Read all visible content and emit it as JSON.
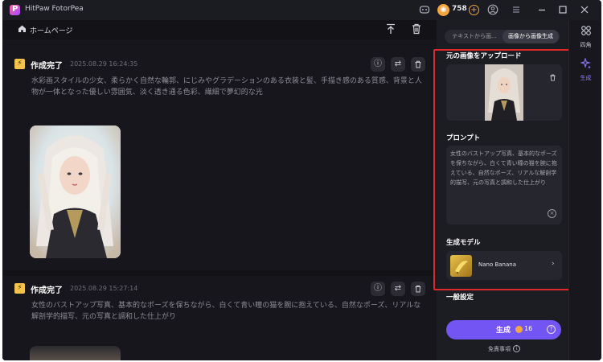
{
  "titlebar": {
    "app_title": "HitPaw FotorPea",
    "coins": "758",
    "icons": [
      "discord-icon",
      "coin-icon",
      "plus-icon",
      "user-icon",
      "menu-icon",
      "minimize-icon",
      "maximize-icon",
      "close-icon"
    ]
  },
  "left": {
    "breadcrumb": "ホームページ",
    "cards": [
      {
        "status": "作成完了",
        "time": "2025.08.29 16:24:35",
        "text": "水彩画スタイルの少女、柔らかく自然な輪郭、にじみやグラデーションのある衣装と髪、手描き感のある質感、背景と人物が一体となった優しい雰囲気、淡く透き通る色彩、繊細で夢幻的な光"
      },
      {
        "status": "作成完了",
        "time": "2025.08.29 15:27:14",
        "text": "女性のバストアップ写真、基本的なポーズを保ちながら、白くて青い瞳の猫を腕に抱えている、自然なポーズ、リアルな解剖学的描写、元の写真と調和した仕上がり"
      }
    ]
  },
  "right": {
    "tabs": [
      {
        "label": "テキストから画...",
        "active": false
      },
      {
        "label": "画像から画像生成",
        "active": true
      }
    ],
    "upload_label": "元の画像をアップロード",
    "prompt_label": "プロンプト",
    "prompt_text": "女性のバストアップ写真、基本的なポーズを保ちながら、白くて青い瞳の猫を腕に抱えている、自然なポーズ、リアルな解剖学的描写、元の写真と調和した仕上がり",
    "model_label": "生成モデル",
    "model_name": "Nano Banana",
    "general_label": "一般設定",
    "generate_label": "生成",
    "generate_cost": "16",
    "disclaimer": "免責事項",
    "highlight_color": "#e02828",
    "accent_color": "#7255f2"
  },
  "rail": {
    "items": [
      {
        "label": "四角",
        "icon": "grid-icon",
        "active": false
      },
      {
        "label": "生成",
        "icon": "sparkle-icon",
        "active": true
      }
    ]
  }
}
